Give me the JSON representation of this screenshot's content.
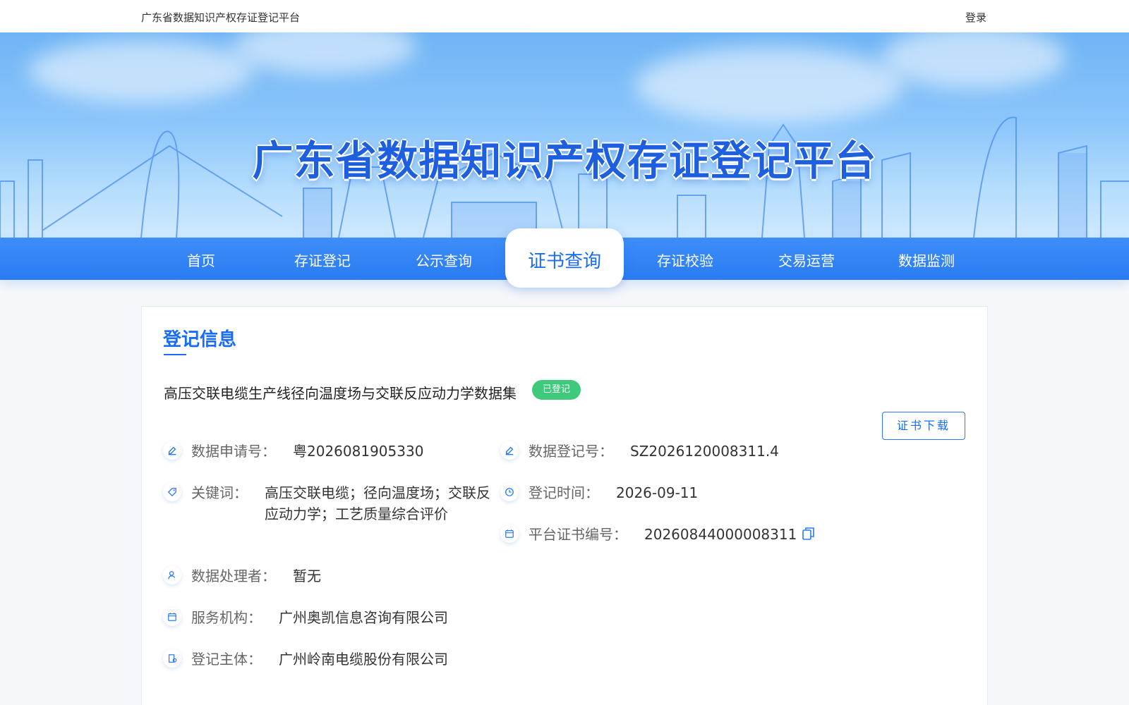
{
  "topbar": {
    "site_name": "广东省数据知识产权存证登记平台",
    "login": "登录"
  },
  "banner": {
    "title": "广东省数据知识产权存证登记平台"
  },
  "nav": {
    "items": [
      "首页",
      "存证登记",
      "公示查询",
      "证书查询",
      "存证校验",
      "交易运营",
      "数据监测"
    ],
    "active": "证书查询"
  },
  "card": {
    "section_title": "登记信息",
    "item_name": "高压交联电缆生产线径向温度场与交联反应动力学数据集",
    "status_badge": "已登记",
    "download_label": "证书下载",
    "fields": {
      "application_no": {
        "label": "数据申请号：",
        "value": "粤2026081905330"
      },
      "registration_no": {
        "label": "数据登记号：",
        "value": "SZ2026120008311.4"
      },
      "keywords": {
        "label": "关键词：",
        "value": "高压交联电缆；径向温度场；交联反应动力学；工艺质量综合评价"
      },
      "registration_time": {
        "label": "登记时间：",
        "value": "2026-09-11"
      },
      "certificate_no": {
        "label": "平台证书编号：",
        "value": "20260844000008311"
      },
      "processor": {
        "label": "数据处理者：",
        "value": "暂无"
      },
      "service_org": {
        "label": "服务机构：",
        "value": "广州奥凯信息咨询有限公司"
      },
      "subject": {
        "label": "登记主体：",
        "value": "广州岭南电缆股份有限公司"
      }
    }
  },
  "colors": {
    "primary": "#1a6cf0",
    "nav_bg": "#2a7bf2",
    "badge_green": "#3ec97c"
  }
}
